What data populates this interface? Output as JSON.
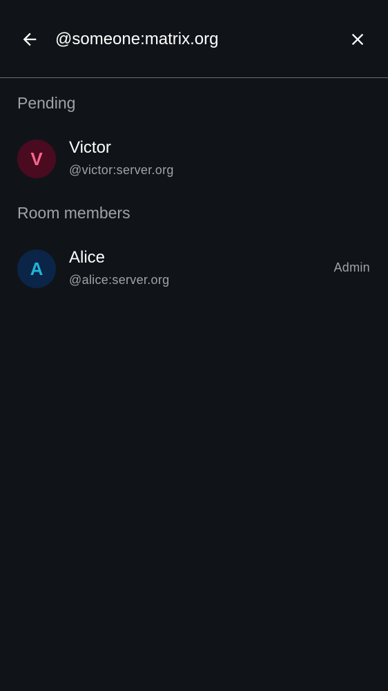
{
  "search": {
    "value": "@someone:matrix.org",
    "back_icon": "arrow-left-icon",
    "clear_icon": "close-icon"
  },
  "sections": {
    "pending": {
      "title": "Pending",
      "members": [
        {
          "initial": "V",
          "name": "Victor",
          "user_id": "@victor:server.org",
          "avatar_bg": "#4a0a1f",
          "avatar_fg": "#f7668e"
        }
      ]
    },
    "room_members": {
      "title": "Room members",
      "members": [
        {
          "initial": "A",
          "name": "Alice",
          "user_id": "@alice:server.org",
          "role": "Admin",
          "avatar_bg": "#0b2548",
          "avatar_fg": "#22b3d5"
        }
      ]
    }
  },
  "colors": {
    "background": "#101418",
    "primary_text": "#ffffff",
    "secondary_text": "#9ea3ab",
    "divider": "#6b6f75"
  }
}
